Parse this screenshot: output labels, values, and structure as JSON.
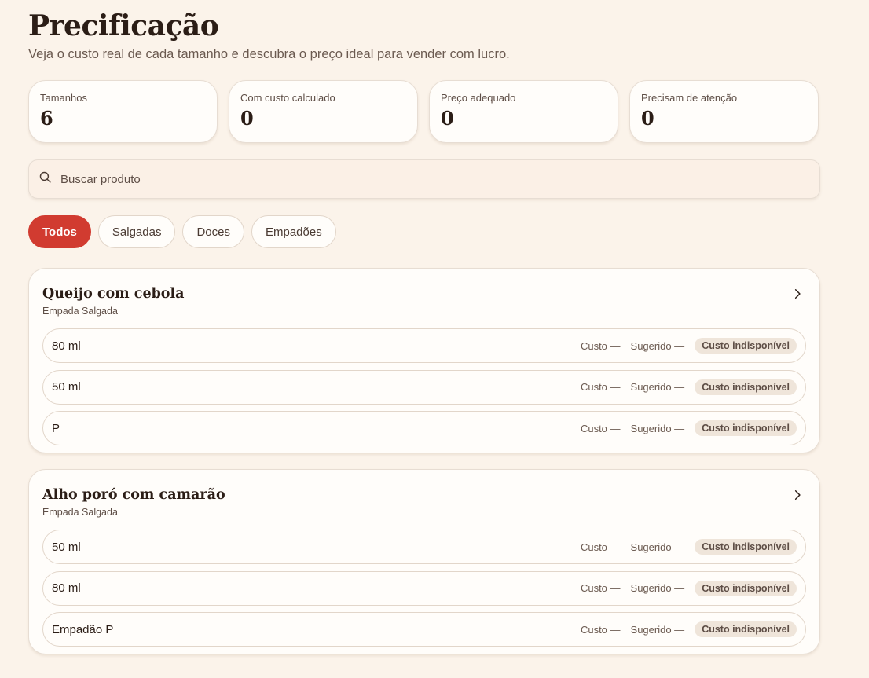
{
  "page": {
    "title": "Precificação",
    "subtitle": "Veja o custo real de cada tamanho e descubra o preço ideal para vender com lucro."
  },
  "stats": [
    {
      "label": "Tamanhos",
      "value": "6"
    },
    {
      "label": "Com custo calculado",
      "value": "0"
    },
    {
      "label": "Preço adequado",
      "value": "0"
    },
    {
      "label": "Precisam de atenção",
      "value": "0"
    }
  ],
  "search": {
    "placeholder": "Buscar produto",
    "icon": "search-icon"
  },
  "filters": [
    {
      "label": "Todos",
      "active": true
    },
    {
      "label": "Salgadas",
      "active": false
    },
    {
      "label": "Doces",
      "active": false
    },
    {
      "label": "Empadões",
      "active": false
    }
  ],
  "row_labels": {
    "custo": "Custo —",
    "sugerido": "Sugerido —",
    "status": "Custo indisponível"
  },
  "products": [
    {
      "name": "Queijo com cebola",
      "category": "Empada Salgada",
      "sizes": [
        {
          "name": "80 ml"
        },
        {
          "name": "50 ml"
        },
        {
          "name": "P"
        }
      ]
    },
    {
      "name": "Alho poró com camarão",
      "category": "Empada Salgada",
      "sizes": [
        {
          "name": "50 ml"
        },
        {
          "name": "80 ml"
        },
        {
          "name": "Empadão P"
        }
      ]
    }
  ],
  "colors": {
    "accent": "#d13b30",
    "background": "#fbf3ea",
    "card": "#fffdfa",
    "badge": "#efe5da"
  }
}
